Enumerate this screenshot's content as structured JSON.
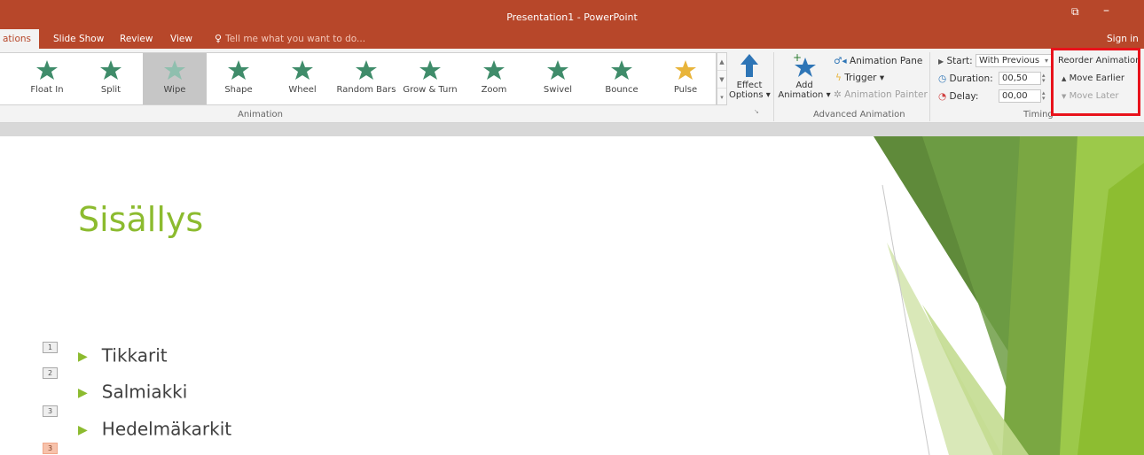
{
  "window": {
    "title": "Presentation1 - PowerPoint",
    "restore_glyph": "⧉",
    "minimize_glyph": "–"
  },
  "tabs": {
    "active": "ations",
    "items": [
      "Slide Show",
      "Review",
      "View"
    ],
    "tell_me": "Tell me what you want to do...",
    "sign_in": "Sign in"
  },
  "animation_gallery": {
    "items": [
      {
        "label": "Float In",
        "icon": "float-in-star-icon",
        "color": "#3f8c6a"
      },
      {
        "label": "Split",
        "icon": "split-star-icon",
        "color": "#3f8c6a"
      },
      {
        "label": "Wipe",
        "icon": "wipe-star-icon",
        "color": "#8fbfae",
        "selected": true
      },
      {
        "label": "Shape",
        "icon": "shape-star-icon",
        "color": "#3f8c6a"
      },
      {
        "label": "Wheel",
        "icon": "wheel-star-icon",
        "color": "#3f8c6a"
      },
      {
        "label": "Random Bars",
        "icon": "random-bars-star-icon",
        "color": "#3f8c6a"
      },
      {
        "label": "Grow & Turn",
        "icon": "grow-turn-star-icon",
        "color": "#3f8c6a"
      },
      {
        "label": "Zoom",
        "icon": "zoom-star-icon",
        "color": "#3f8c6a"
      },
      {
        "label": "Swivel",
        "icon": "swivel-star-icon",
        "color": "#3f8c6a"
      },
      {
        "label": "Bounce",
        "icon": "bounce-star-icon",
        "color": "#3f8c6a"
      },
      {
        "label": "Pulse",
        "icon": "pulse-star-icon",
        "color": "#e8b43a"
      }
    ],
    "group_label": "Animation",
    "effect_options": {
      "line1": "Effect",
      "line2": "Options ▾"
    }
  },
  "advanced_animation": {
    "add_animation": {
      "line1": "Add",
      "line2": "Animation ▾"
    },
    "animation_pane": "Animation Pane",
    "trigger": "Trigger ▾",
    "animation_painter": "Animation Painter",
    "group_label": "Advanced Animation"
  },
  "timing": {
    "start_label": "Start:",
    "start_value": "With Previous",
    "duration_label": "Duration:",
    "duration_value": "00,50",
    "delay_label": "Delay:",
    "delay_value": "00,00",
    "group_label": "Timing"
  },
  "reorder": {
    "title": "Reorder Animation",
    "move_earlier": "Move Earlier",
    "move_later": "Move Later"
  },
  "slide": {
    "title": "Sisällys",
    "bullets": [
      "Tikkarit",
      "Salmiakki",
      "Hedelmäkarkit"
    ],
    "badges": [
      "1",
      "2",
      "3",
      "3"
    ]
  },
  "colors": {
    "accent": "#b7472a",
    "title_green": "#8cbb2f",
    "highlight_red": "#e8121b"
  }
}
